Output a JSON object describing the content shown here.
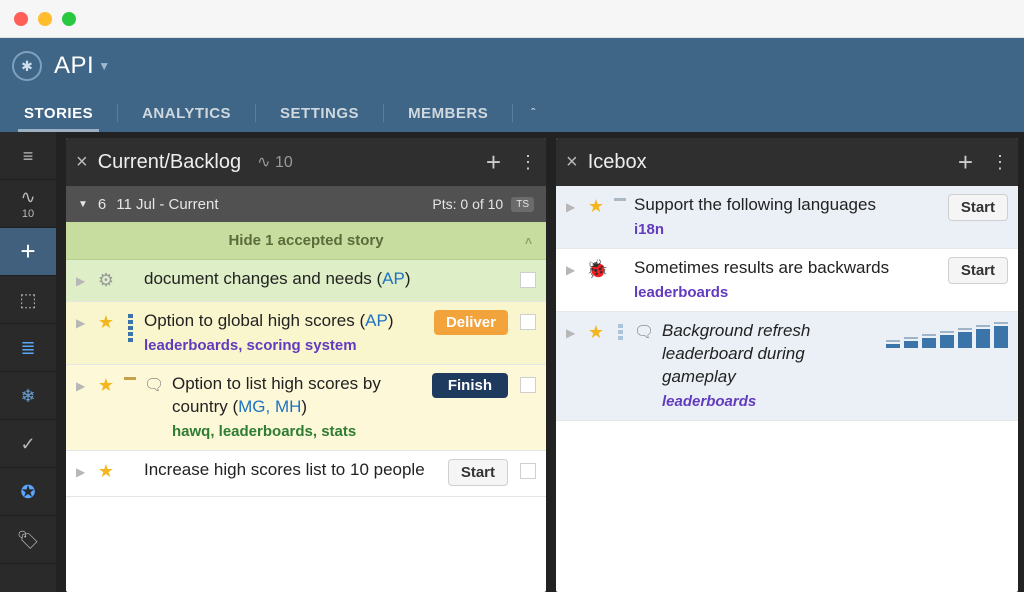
{
  "project": {
    "name": "API"
  },
  "tabs": {
    "stories": "STORIES",
    "analytics": "ANALYTICS",
    "settings": "SETTINGS",
    "members": "MEMBERS"
  },
  "rail": {
    "velocity": "10"
  },
  "panelA": {
    "title": "Current/Backlog",
    "points": "10",
    "iteration": {
      "num": "6",
      "date": "11 Jul - Current",
      "pts": "Pts: 0 of 10",
      "team": "TS"
    },
    "acceptedBanner": "Hide 1 accepted story",
    "stories": [
      {
        "title": "document changes and needs (",
        "owner": "AP",
        "tail": ")"
      },
      {
        "title": "Option to global high scores (",
        "owner": "AP",
        "tail": ")",
        "labels": "leaderboards, scoring system",
        "action": "Deliver"
      },
      {
        "title": "Option to list high scores by country (",
        "owner": "MG, MH",
        "tail": ")",
        "labels": "hawq, leaderboards, stats",
        "action": "Finish"
      },
      {
        "title": "Increase high scores list to 10 people",
        "action": "Start"
      }
    ]
  },
  "panelB": {
    "title": "Icebox",
    "stories": [
      {
        "title": "Support the following languages",
        "labels": "i18n",
        "action": "Start"
      },
      {
        "title": "Sometimes results are backwards",
        "labels": "leaderboards",
        "action": "Start"
      },
      {
        "title": "Background refresh leaderboard during gameplay",
        "labels": "leaderboards"
      }
    ]
  }
}
